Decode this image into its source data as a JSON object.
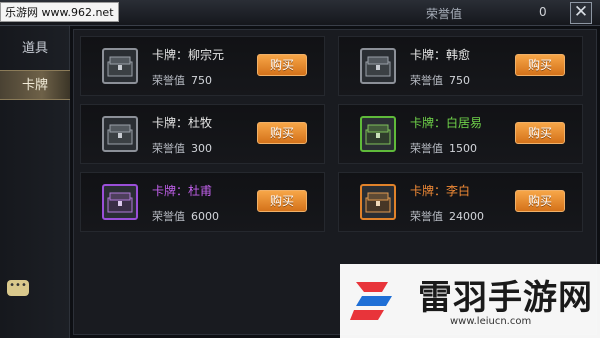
{
  "watermark_top": "乐游网 www.962.net",
  "header": {
    "honor_label": "荣誉值",
    "honor_value": "0",
    "close_icon": "✕"
  },
  "sidebar": {
    "items": [
      {
        "label": "道具"
      },
      {
        "label": "卡牌"
      }
    ]
  },
  "cards": [
    {
      "name": "卡牌：柳宗元",
      "honor_label": "荣誉值",
      "honor": "750",
      "buy_label": "购买",
      "rarity": "gray"
    },
    {
      "name": "卡牌：韩愈",
      "honor_label": "荣誉值",
      "honor": "750",
      "buy_label": "购买",
      "rarity": "gray"
    },
    {
      "name": "卡牌：杜牧",
      "honor_label": "荣誉值",
      "honor": "300",
      "buy_label": "购买",
      "rarity": "gray"
    },
    {
      "name": "卡牌：白居易",
      "honor_label": "荣誉值",
      "honor": "1500",
      "buy_label": "购买",
      "rarity": "green"
    },
    {
      "name": "卡牌：杜甫",
      "honor_label": "荣誉值",
      "honor": "6000",
      "buy_label": "购买",
      "rarity": "purple"
    },
    {
      "name": "卡牌：李白",
      "honor_label": "荣誉值",
      "honor": "24000",
      "buy_label": "购买",
      "rarity": "orange"
    }
  ],
  "colors": {
    "gray": "#8c9098",
    "green": "#6fd24a",
    "purple": "#c060ea",
    "orange": "#f08a36",
    "button": "#e88a2c"
  },
  "watermark_bottom": {
    "title": "雷羽手游网",
    "url": "www.leiucn.com"
  }
}
